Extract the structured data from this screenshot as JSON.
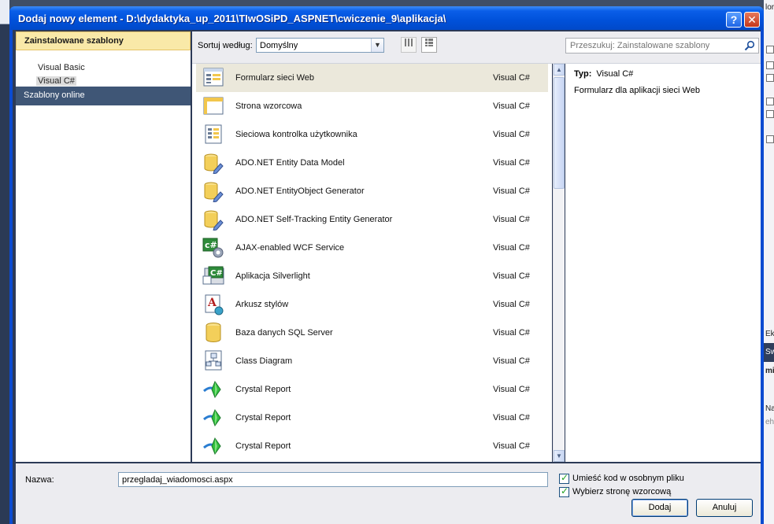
{
  "window": {
    "title": "Dodaj nowy element - D:\\dydaktyka_up_2011\\TIwOSiPD_ASPNET\\cwiczenie_9\\aplikacja\\",
    "help_glyph": "?",
    "close_glyph": "✕"
  },
  "left_panel": {
    "installed_header": "Zainstalowane szablony",
    "items": [
      "Visual Basic",
      "Visual C#"
    ],
    "selected_item": "Visual C#",
    "online": "Szablony online"
  },
  "toolbar": {
    "sort_label": "Sortuj według:",
    "sort_value": "Domyślny",
    "search_placeholder": "Przeszukuj: Zainstalowane szablony"
  },
  "templates": [
    {
      "name": "Formularz sieci Web",
      "lang": "Visual C#",
      "icon": "webform-icon",
      "selected": true
    },
    {
      "name": "Strona wzorcowa",
      "lang": "Visual C#",
      "icon": "masterpage-icon"
    },
    {
      "name": "Sieciowa kontrolka użytkownika",
      "lang": "Visual C#",
      "icon": "usercontrol-icon"
    },
    {
      "name": "ADO.NET Entity Data Model",
      "lang": "Visual C#",
      "icon": "database-pencil-icon"
    },
    {
      "name": "ADO.NET EntityObject Generator",
      "lang": "Visual C#",
      "icon": "database-pencil-icon"
    },
    {
      "name": "ADO.NET Self-Tracking Entity Generator",
      "lang": "Visual C#",
      "icon": "database-pencil-icon"
    },
    {
      "name": "AJAX-enabled WCF Service",
      "lang": "Visual C#",
      "icon": "wcf-service-icon"
    },
    {
      "name": "Aplikacja Silverlight",
      "lang": "Visual C#",
      "icon": "silverlight-app-icon"
    },
    {
      "name": "Arkusz stylów",
      "lang": "Visual C#",
      "icon": "stylesheet-icon"
    },
    {
      "name": "Baza danych SQL Server",
      "lang": "Visual C#",
      "icon": "database-icon"
    },
    {
      "name": "Class Diagram",
      "lang": "Visual C#",
      "icon": "class-diagram-icon"
    },
    {
      "name": "Crystal Report",
      "lang": "Visual C#",
      "icon": "crystal-report-icon"
    },
    {
      "name": "Crystal Report",
      "lang": "Visual C#",
      "icon": "crystal-report-icon"
    },
    {
      "name": "Crystal Report",
      "lang": "Visual C#",
      "icon": "crystal-report-icon"
    }
  ],
  "description": {
    "type_label": "Typ:",
    "type_value": "Visual C#",
    "text": "Formularz dla aplikacji sieci Web"
  },
  "bottom": {
    "name_label": "Nazwa:",
    "name_value": "przegladaj_wiadomosci.aspx",
    "checkbox_separate_file": {
      "label": "Umieść kod w osobnym pliku",
      "checked": true
    },
    "checkbox_master_page": {
      "label": "Wybierz stronę wzorcową",
      "checked": true
    },
    "add_button": "Dodaj",
    "cancel_button": "Anuluj"
  },
  "background_fragments": {
    "right_text_top": "lor",
    "right_text_1": "Ek",
    "right_text_2": "Św",
    "right_text_3": "mi",
    "right_text_4": "Naz",
    "right_text_5": "eh"
  },
  "colors": {
    "titlebar": "#0a5ee8",
    "selected_row": "#ebe8db",
    "header_yellow": "#f9e9a8",
    "online_bar": "#3f5676"
  }
}
